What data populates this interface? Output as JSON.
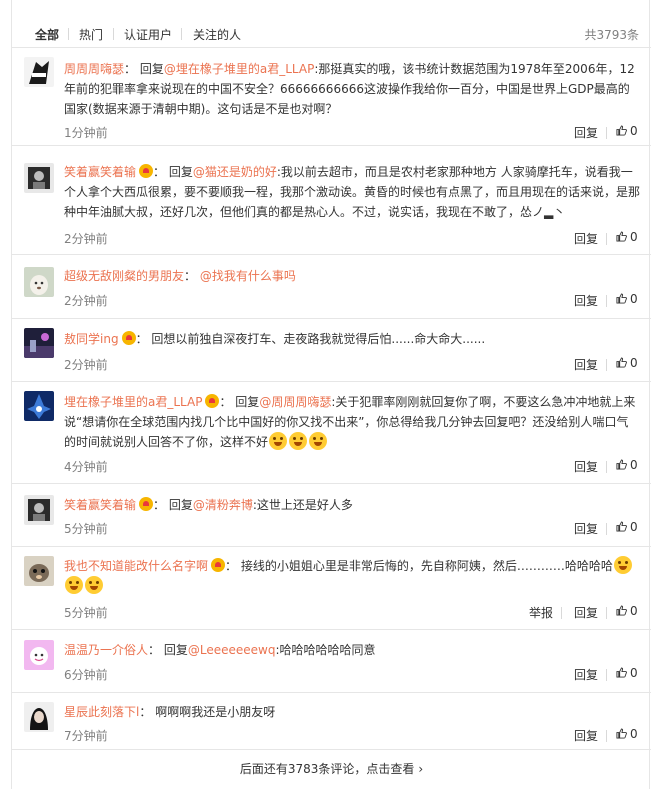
{
  "tabs": [
    {
      "label": "全部"
    },
    {
      "label": "热门"
    },
    {
      "label": "认证用户"
    },
    {
      "label": "关注的人"
    }
  ],
  "total_count": "共3793条",
  "actions": {
    "reply": "回复",
    "report": "举报",
    "like_count": "0"
  },
  "comments": [
    {
      "user": "周周周嗨瑟",
      "sep": "：",
      "prefix": "回复",
      "mention": "@埋在橡子堆里的a君_LLAP",
      "text": ":那挺真实的哦，该书统计数据范围为1978年至2006年，12年前的犯罪率拿来说现在的中国不安全？66666666666这波操作我给你一百分，中国是世界上GDP最高的国家(数据来源于清朝中期)。这句话是不是也对啊？",
      "time": "1分钟前"
    },
    {
      "user": "笑着赢笑着输",
      "sep": "：",
      "prefix": "回复",
      "mention": "@猫还是奶的好",
      "text": ":我以前去超市，而且是农村老家那种地方 人家骑摩托车，说看我一个人拿个大西瓜很累，要不要顺我一程，我那个激动诶。黄昏的时候也有点黑了，而且用现在的话来说，是那种中年油腻大叔，还好几次，但他们真的都是热心人。不过，说实话，我现在不敢了，怂ノ▂丶",
      "time": "2分钟前"
    },
    {
      "user": "超级无敌刚粲的男朋友",
      "sep": "：",
      "prefix": "",
      "mention": "@找我有什么事吗",
      "text": "",
      "time": "2分钟前"
    },
    {
      "user": "敖同学ing",
      "sep": "：",
      "prefix": "",
      "mention": "",
      "text": "回想以前独自深夜打车、走夜路我就觉得后怕......命大命大......",
      "time": "2分钟前"
    },
    {
      "user": "埋在橡子堆里的a君_LLAP",
      "sep": "：",
      "prefix": "回复",
      "mention": "@周周周嗨瑟",
      "text": ":关于犯罪率刚刚就回复你了啊，不要这么急冲冲地就上来说“想请你在全球范围内找几个比中国好的你又找不出来”，你总得给我几分钟去回复吧？还没给别人喘口气的时间就说别人回答不了你，这样不好",
      "time": "4分钟前"
    },
    {
      "user": "笑着赢笑着输",
      "sep": "：",
      "prefix": "回复",
      "mention": "@清粉奔博",
      "text": ":这世上还是好人多",
      "time": "5分钟前"
    },
    {
      "user": "我也不知道能改什么名字啊",
      "sep": "：",
      "prefix": "",
      "mention": "",
      "text": "接线的小姐姐心里是非常后悔的，先自称阿姨，然后…………哈哈哈哈",
      "time": "5分钟前"
    },
    {
      "user": "温温乃一介俗人",
      "sep": "：",
      "prefix": "回复",
      "mention": "@Leeeeeeewq",
      "text": ":哈哈哈哈哈哈同意",
      "time": "6分钟前"
    },
    {
      "user": "星辰此刻落下l",
      "sep": "：",
      "prefix": "",
      "mention": "",
      "text": "啊啊啊我还是小朋友呀",
      "time": "7分钟前"
    }
  ],
  "footer": {
    "more_text": "后面还有3783条评论，点击查看",
    "chevron": "›"
  },
  "colors": {
    "accent": "#eb7350",
    "muted": "#808080"
  }
}
